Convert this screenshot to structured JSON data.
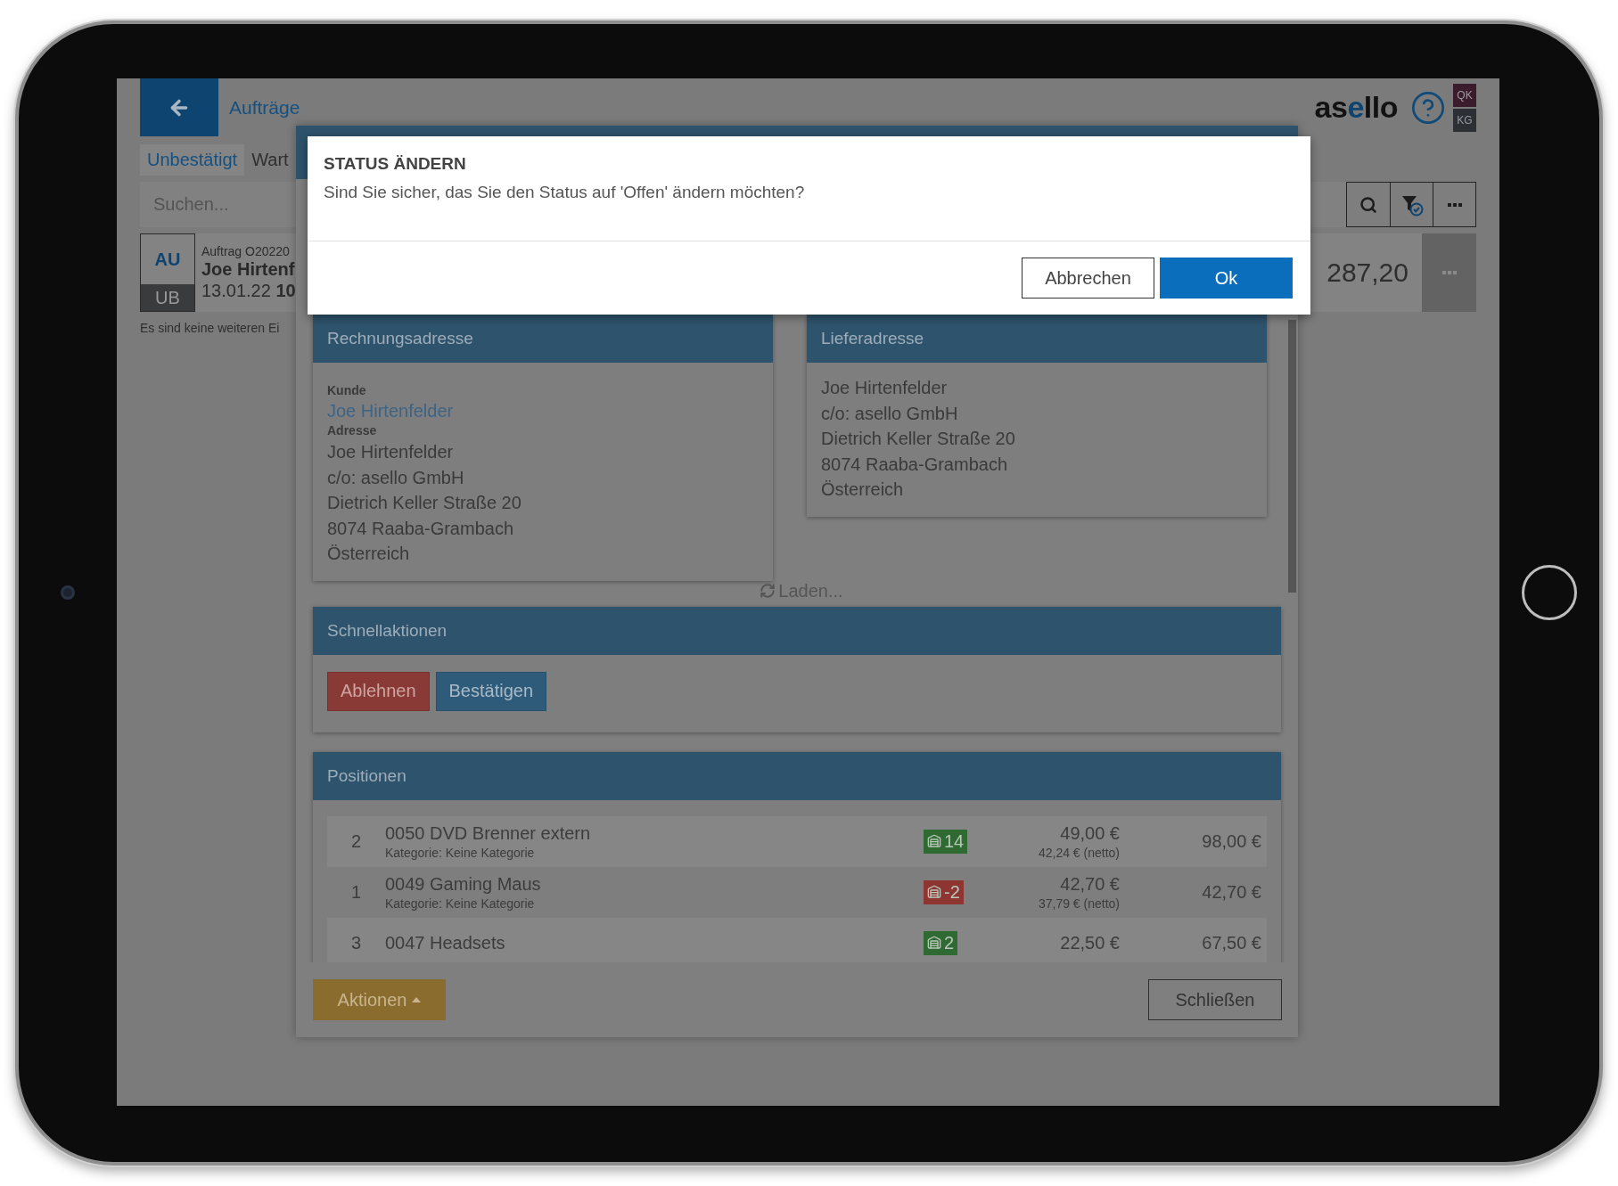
{
  "header": {
    "title": "Aufträge",
    "logo_parts": [
      {
        "text": "as",
        "accent": false
      },
      {
        "text": "e",
        "accent": true
      },
      {
        "text": "llo",
        "accent": false
      }
    ],
    "user_badges": [
      {
        "label": "QK",
        "color": "#3a1c2c"
      },
      {
        "label": "KG",
        "color": "#2c3034"
      }
    ]
  },
  "tabs": [
    {
      "label": "Unbestätigt",
      "selected": true
    },
    {
      "label": "Wart",
      "selected": false
    }
  ],
  "search": {
    "placeholder": "Suchen..."
  },
  "orders": [
    {
      "type_code": "AU",
      "status_code": "UB",
      "number": "Auftrag O20220",
      "customer": "Joe Hirtenf",
      "date": "13.01.22",
      "time": "10",
      "total": "287,20"
    }
  ],
  "list_note": "Es sind keine weiteren Ei",
  "order_dialog": {
    "billing_address": {
      "title": "Rechnungsadresse",
      "customer_label": "Kunde",
      "customer": "Joe Hirtenfelder",
      "address_label": "Adresse",
      "lines": [
        "Joe Hirtenfelder",
        "c/o: asello GmbH",
        "Dietrich Keller Straße 20",
        "8074 Raaba-Grambach",
        "Österreich"
      ]
    },
    "delivery_address": {
      "title": "Lieferadresse",
      "lines": [
        "Joe Hirtenfelder",
        "c/o: asello GmbH",
        "Dietrich Keller Straße 20",
        "8074 Raaba-Grambach",
        "Österreich"
      ]
    },
    "loading": "Laden...",
    "quick_actions": {
      "title": "Schnellaktionen",
      "buttons": [
        {
          "label": "Ablehnen",
          "kind": "danger"
        },
        {
          "label": "Bestätigen",
          "kind": "primary"
        }
      ]
    },
    "positions": {
      "title": "Positionen",
      "rows": [
        {
          "quantity": "2",
          "name": "0050 DVD Brenner extern",
          "category": "Kategorie: Keine Kategorie",
          "stock": {
            "value": "14",
            "color": "#2f6a32"
          },
          "price": "49,00 €",
          "net_price": "42,24 € (netto)",
          "total": "98,00 €"
        },
        {
          "quantity": "1",
          "name": "0049 Gaming Maus",
          "category": "Kategorie: Keine Kategorie",
          "stock": {
            "value": "-2",
            "color": "#8e3431"
          },
          "price": "42,70 €",
          "net_price": "37,79 € (netto)",
          "total": "42,70 €"
        },
        {
          "quantity": "3",
          "name": "0047 Headsets",
          "stock": {
            "value": "2",
            "color": "#2f6a32"
          },
          "price": "22,50 €",
          "total": "67,50 €"
        }
      ]
    },
    "footer": {
      "actions": "Aktionen",
      "close": "Schließen"
    }
  },
  "confirm_dialog": {
    "title": "STATUS ÄNDERN",
    "message": "Sind Sie sicher, das Sie den Status auf 'Offen' ändern möchten?",
    "buttons": [
      {
        "label": "Abbrechen",
        "kind": "secondary"
      },
      {
        "label": "Ok",
        "kind": "primary"
      }
    ]
  }
}
